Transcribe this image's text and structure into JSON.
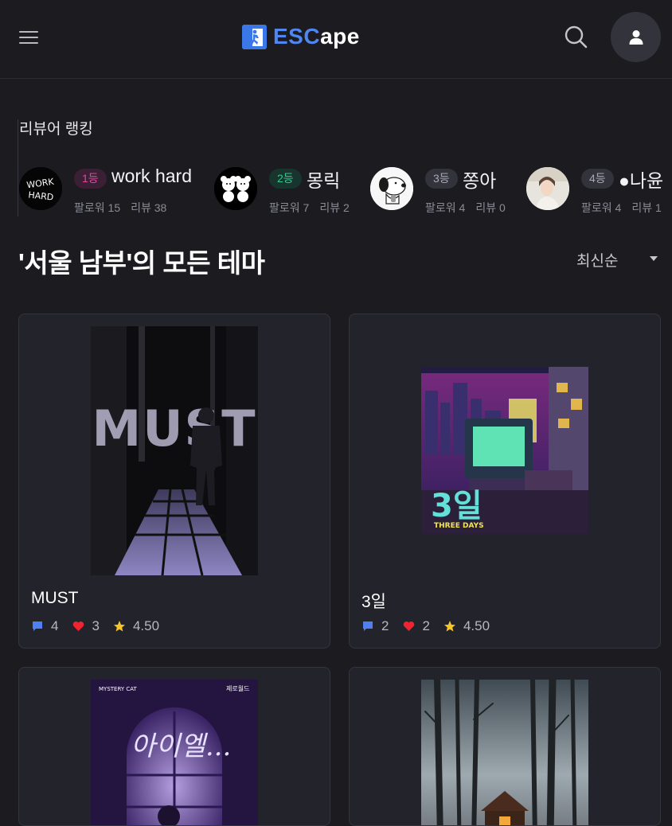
{
  "header": {
    "logo_esc": "ESC",
    "logo_ape": "ape",
    "menu_icon": "hamburger-menu-icon",
    "search_icon": "search-icon",
    "profile_icon": "user-icon",
    "brand_color": "#4f86f0"
  },
  "ranking": {
    "title": "리뷰어 랭킹",
    "rankers": [
      {
        "rank": "1등",
        "name": "work hard",
        "followers": "팔로워 15",
        "reviews": "리뷰 38",
        "badge_color": "#c03a8a"
      },
      {
        "rank": "2등",
        "name": "몽릭",
        "followers": "팔로워 7",
        "reviews": "리뷰 2",
        "badge_color": "#2fbf8a"
      },
      {
        "rank": "3등",
        "name": "쫑아",
        "followers": "팔로워 4",
        "reviews": "리뷰 0",
        "badge_color": "#9a9aa6"
      },
      {
        "rank": "4등",
        "name": "●나윤",
        "followers": "팔로워 4",
        "reviews": "리뷰 1",
        "badge_color": "#9a9aa6"
      }
    ]
  },
  "section": {
    "title": "'서울 남부'의 모든 테마",
    "sort_value": "최신순"
  },
  "themes": [
    {
      "title": "MUST",
      "comments": "4",
      "likes": "3",
      "rating": "4.50",
      "poster_text": "MUST"
    },
    {
      "title": "3일",
      "comments": "2",
      "likes": "2",
      "rating": "4.50",
      "poster_text": "3일",
      "poster_subtext": "THREE DAYS"
    },
    {
      "title": "",
      "poster_text": "아이엘...",
      "poster_brand_left": "MYSTERY CAT",
      "poster_brand_right": "제로월드"
    },
    {
      "title": "",
      "poster_text": ""
    }
  ],
  "colors": {
    "comment": "#4f7ff0",
    "like": "#f0242f",
    "star": "#f7c52a"
  }
}
